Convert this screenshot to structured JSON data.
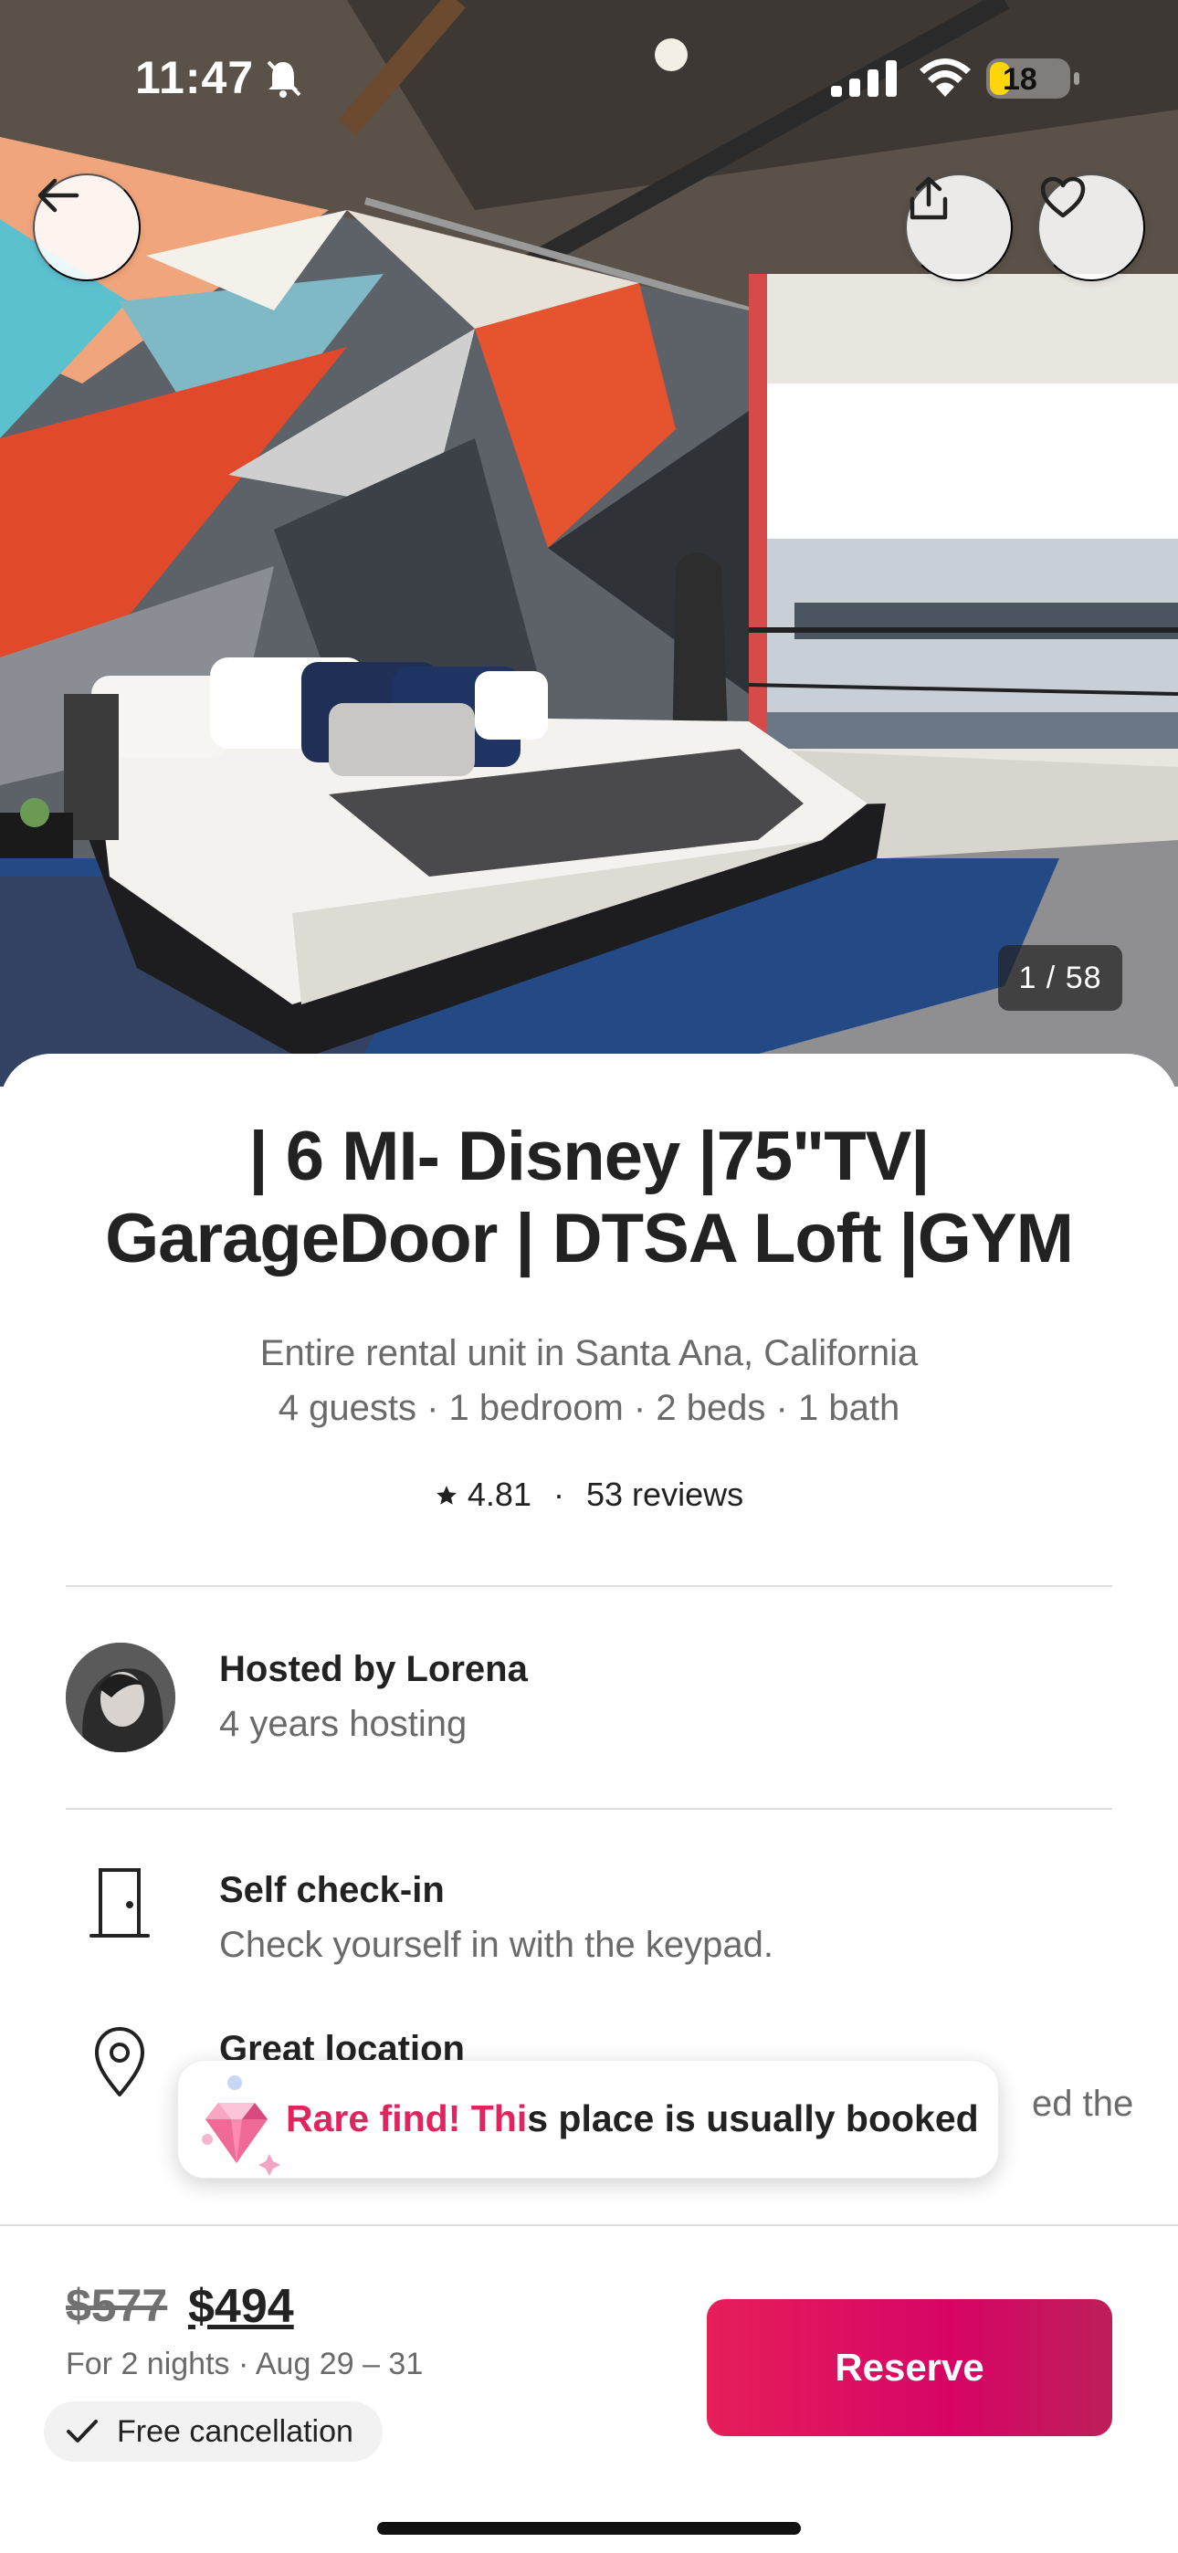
{
  "status_bar": {
    "time": "11:47",
    "battery": "18"
  },
  "photo": {
    "counter": "1 / 58"
  },
  "listing": {
    "title": "| 6 MI- Disney |75\"TV| GarageDoor | DTSA Loft |GYM",
    "subtitle_line1": "Entire rental unit in Santa Ana, California",
    "subtitle_line2": "4 guests · 1 bedroom · 2 beds · 1 bath",
    "rating": "4.81",
    "separator": "·",
    "reviews": "53 reviews"
  },
  "host": {
    "name": "Hosted by Lorena",
    "years": "4 years hosting"
  },
  "features": [
    {
      "icon": "door-icon",
      "title": "Self check-in",
      "desc": "Check yourself in with the keypad."
    },
    {
      "icon": "location-pin-icon",
      "title": "Great location",
      "desc_tail": "ed the"
    }
  ],
  "toast": {
    "highlight": "Rare find! Thi",
    "rest": "s place is usually booked"
  },
  "footer": {
    "old_price": "$577",
    "price": "$494",
    "dates": "For 2 nights · Aug 29 – 31",
    "free_cancellation": "Free cancellation",
    "reserve_label": "Reserve"
  },
  "colors": {
    "accent": "#E31C5F",
    "text": "#222222",
    "muted": "#6A6A6A",
    "divider": "#DDDDDD"
  }
}
